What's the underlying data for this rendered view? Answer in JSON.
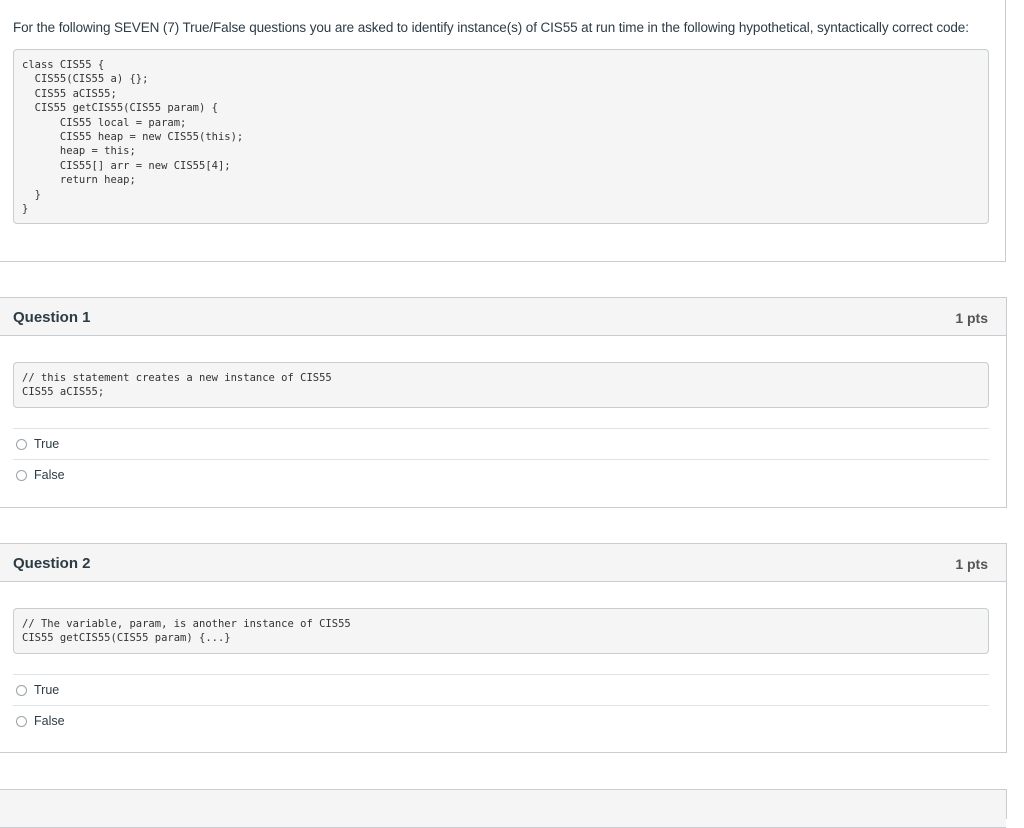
{
  "intro": {
    "text": "For the following SEVEN (7) True/False questions you are asked to identify instance(s) of CIS55 at run time in the following hypothetical, syntactically correct code:",
    "code": [
      "class CIS55 {",
      "  CIS55(CIS55 a) {};",
      "  CIS55 aCIS55;",
      "  CIS55 getCIS55(CIS55 param) {",
      "      CIS55 local = param;",
      "      CIS55 heap = new CIS55(this);",
      "      heap = this;",
      "      CIS55[] arr = new CIS55[4];",
      "      return heap;",
      "  }",
      "}"
    ]
  },
  "questions": [
    {
      "title": "Question 1",
      "points": "1 pts",
      "code": [
        "// this statement creates a new instance of CIS55",
        "CIS55 aCIS55;"
      ],
      "answers": [
        "True",
        "False"
      ]
    },
    {
      "title": "Question 2",
      "points": "1 pts",
      "code": [
        "// The variable, param, is another instance of CIS55",
        "CIS55 getCIS55(CIS55 param) {...}"
      ],
      "answers": [
        "True",
        "False"
      ]
    }
  ]
}
